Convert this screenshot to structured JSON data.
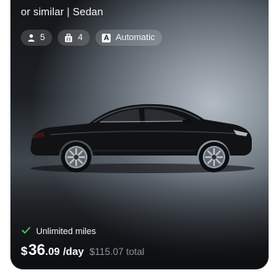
{
  "listing": {
    "subtitle": "or similar | Sedan",
    "specs": {
      "seats": "5",
      "bags": "4",
      "transmission": "Automatic"
    },
    "feature": "Unlimited miles",
    "price": {
      "currency": "$",
      "integer": "36",
      "decimal": ".09",
      "per": "/day",
      "total": "$115.07 total"
    },
    "colors": {
      "check": "#59c36a",
      "text": "#f2f3f5",
      "muted": "#8f969d"
    },
    "icons": [
      "person-icon",
      "luggage-icon",
      "transmission-icon",
      "checkmark-icon"
    ]
  }
}
